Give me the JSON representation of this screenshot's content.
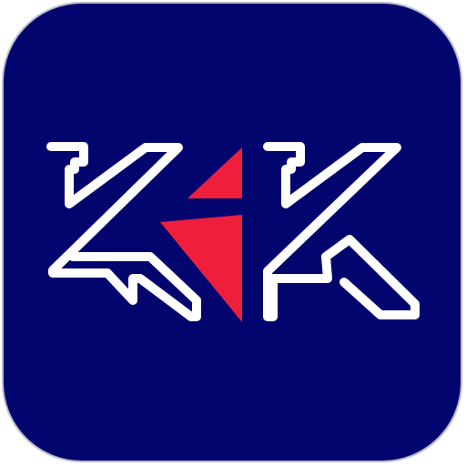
{
  "app_icon": {
    "name": "KK",
    "background_color": "#03056f",
    "border_color": "#b9b9c9",
    "outline_color": "#ffffff",
    "accent_color": "#ef1f3c"
  }
}
